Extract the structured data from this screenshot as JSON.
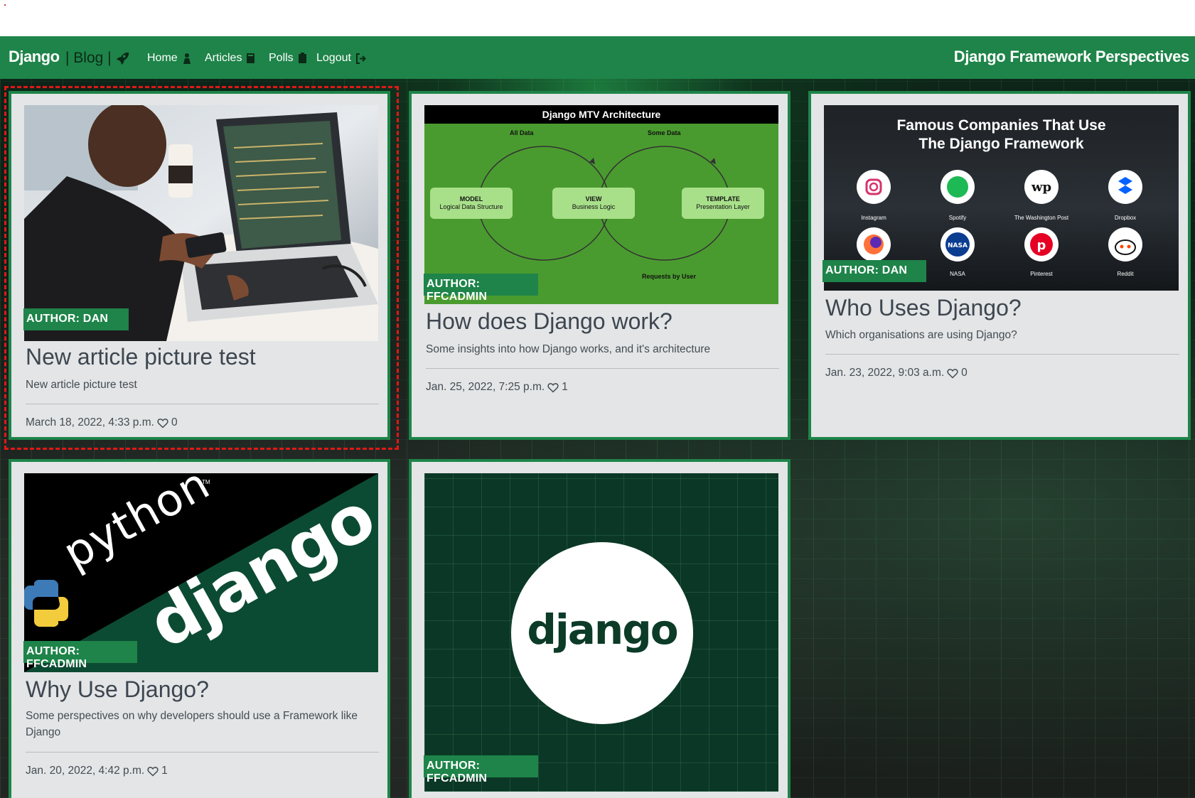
{
  "navbar": {
    "brand": "Django",
    "blog": "| Blog |",
    "items": [
      {
        "label": "Home",
        "icon": "person-icon"
      },
      {
        "label": "Articles",
        "icon": "book-icon"
      },
      {
        "label": "Polls",
        "icon": "clipboard-icon"
      },
      {
        "label": "Logout",
        "icon": "logout-icon"
      }
    ],
    "site_title": "Django Framework Perspectives"
  },
  "articles": [
    {
      "author": "AUTHOR: DAN",
      "title": "New article picture test",
      "description": "New article picture test",
      "date": "March 18, 2022, 4:33 p.m.",
      "likes": "0"
    },
    {
      "author": "AUTHOR: FFCADMIN",
      "title": "How does Django work?",
      "description": "Some insights into how Django works, and it's architecture",
      "date": "Jan. 25, 2022, 7:25 p.m.",
      "likes": "1",
      "image": {
        "heading": "Django MTV Architecture",
        "top_left": "All Data",
        "top_right": "Some Data",
        "model": "MODEL",
        "model_sub": "Logical Data Structure",
        "view": "VIEW",
        "view_sub": "Business Logic",
        "template": "TEMPLATE",
        "template_sub": "Presentation Layer",
        "bottom_right": "Requests by User"
      }
    },
    {
      "author": "AUTHOR: DAN",
      "title": "Who Uses Django?",
      "description": "Which organisations are using Django?",
      "date": "Jan. 23, 2022, 9:03 a.m.",
      "likes": "0",
      "image": {
        "heading_line1": "Famous Companies That Use",
        "heading_line2": "The Django Framework",
        "companies": [
          "Instagram",
          "Spotify",
          "The Washington Post",
          "Dropbox",
          "Firefox",
          "NASA",
          "Pinterest",
          "Reddit"
        ]
      }
    },
    {
      "author": "AUTHOR: FFCADMIN",
      "title": "Why Use Django?",
      "description": "Some perspectives on why developers should use a Framework like Django",
      "date": "Jan. 20, 2022, 4:42 p.m.",
      "likes": "1",
      "image": {
        "python": "python",
        "tm": "TM",
        "django": "django"
      }
    },
    {
      "author": "AUTHOR: FFCADMIN",
      "image": {
        "logo": "django"
      }
    }
  ],
  "colors": {
    "accent": "#1e8449",
    "card_bg": "#e3e5e6",
    "selection": "#e01818"
  }
}
